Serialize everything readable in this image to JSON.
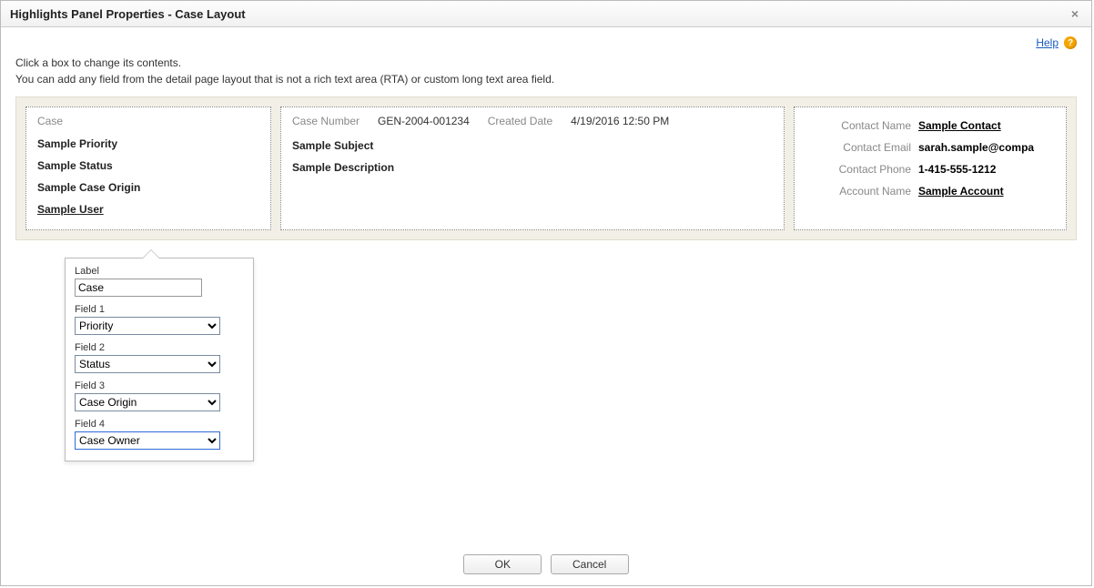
{
  "window": {
    "title": "Highlights Panel Properties - Case Layout",
    "close_glyph": "×"
  },
  "help": {
    "link_text": "Help",
    "icon_glyph": "?"
  },
  "instructions": {
    "line1": "Click a box to change its contents.",
    "line2": "You can add any field from the detail page layout that is not a rich text area (RTA) or custom long text area field."
  },
  "panel": {
    "col1": {
      "header": "Case",
      "items": [
        {
          "text": "Sample Priority",
          "underlined": false
        },
        {
          "text": "Sample Status",
          "underlined": false
        },
        {
          "text": "Sample Case Origin",
          "underlined": false
        },
        {
          "text": "Sample User",
          "underlined": true
        }
      ]
    },
    "col2": {
      "header": {
        "case_number_label": "Case Number",
        "case_number_value": "GEN-2004-001234",
        "created_date_label": "Created Date",
        "created_date_value": "4/19/2016 12:50 PM"
      },
      "lines": [
        "Sample Subject",
        "Sample Description"
      ]
    },
    "col3": {
      "rows": [
        {
          "label": "Contact Name",
          "value": "Sample Contact",
          "link": true
        },
        {
          "label": "Contact Email",
          "value": "sarah.sample@compa",
          "link": false
        },
        {
          "label": "Contact Phone",
          "value": "1-415-555-1212",
          "link": false
        },
        {
          "label": "Account Name",
          "value": "Sample Account",
          "link": true
        }
      ]
    }
  },
  "popover": {
    "label_label": "Label",
    "label_value": "Case",
    "fields": [
      {
        "label": "Field 1",
        "value": "Priority",
        "active": false
      },
      {
        "label": "Field 2",
        "value": "Status",
        "active": false
      },
      {
        "label": "Field 3",
        "value": "Case Origin",
        "active": false
      },
      {
        "label": "Field 4",
        "value": "Case Owner",
        "active": true
      }
    ]
  },
  "footer": {
    "ok": "OK",
    "cancel": "Cancel"
  }
}
